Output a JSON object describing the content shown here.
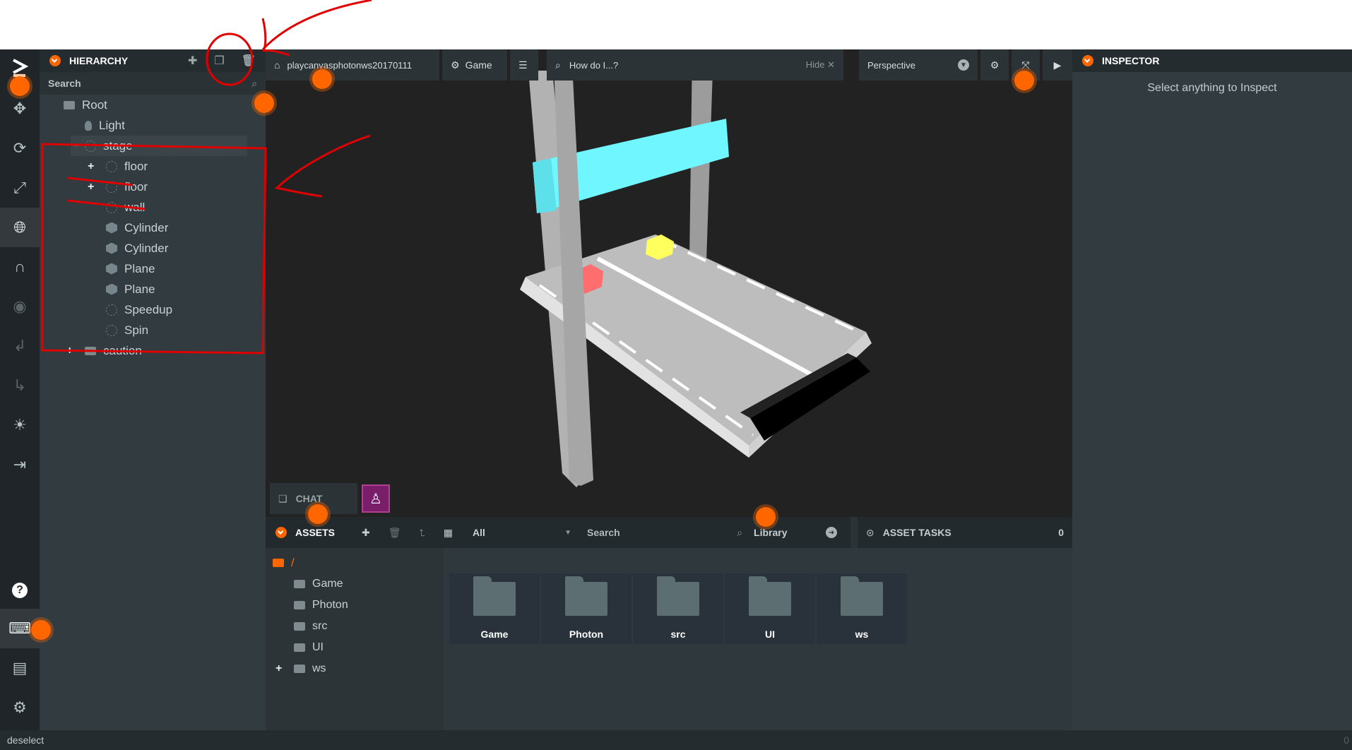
{
  "toolbar": {
    "tools": [
      "logo-icon",
      "move-icon",
      "rotate-icon",
      "scale-icon",
      "world-icon",
      "magnet-icon",
      "eye-icon",
      "undo-icon",
      "redo-icon",
      "light-icon",
      "publish-icon"
    ],
    "bottom_tools": [
      "help-icon",
      "keyboard-icon",
      "feedback-icon",
      "settings-icon"
    ]
  },
  "hierarchy": {
    "title": "HIERARCHY",
    "search_label": "Search",
    "items": [
      {
        "label": "Root",
        "icon": "folder-icon",
        "expander": ""
      },
      {
        "label": "Light",
        "icon": "bulb-icon",
        "expander": ""
      },
      {
        "label": "stage",
        "icon": "entity-icon",
        "expander": "−"
      },
      {
        "label": "floor",
        "icon": "entity-icon",
        "expander": "+"
      },
      {
        "label": "floor",
        "icon": "entity-icon",
        "expander": "+"
      },
      {
        "label": "wall",
        "icon": "entity-icon",
        "expander": ""
      },
      {
        "label": "Cylinder",
        "icon": "box-icon",
        "expander": ""
      },
      {
        "label": "Cylinder",
        "icon": "box-icon",
        "expander": ""
      },
      {
        "label": "Plane",
        "icon": "box-icon",
        "expander": ""
      },
      {
        "label": "Plane",
        "icon": "box-icon",
        "expander": ""
      },
      {
        "label": "Speedup",
        "icon": "entity-icon",
        "expander": ""
      },
      {
        "label": "Spin",
        "icon": "entity-icon",
        "expander": ""
      },
      {
        "label": "caution",
        "icon": "folder-icon",
        "expander": "+"
      }
    ]
  },
  "viewport": {
    "project_name": "playcanvasphotonws20170111",
    "game_label": "Game",
    "help_search": "How do I...?",
    "hide_label": "Hide",
    "camera": "Perspective"
  },
  "chat": {
    "label": "CHAT"
  },
  "assets": {
    "title": "ASSETS",
    "filter": "All",
    "search_label": "Search",
    "library_label": "Library",
    "tasks_title": "ASSET TASKS",
    "tasks_count": "0",
    "root": "/",
    "folders": [
      "Game",
      "Photon",
      "src",
      "UI",
      "ws"
    ]
  },
  "inspector": {
    "title": "INSPECTOR",
    "empty_text": "Select anything to Inspect"
  },
  "status": {
    "text": "deselect",
    "count": "0"
  },
  "colors": {
    "accent": "#ff6600",
    "annotation": "#e00000",
    "cyan_bar": "#6ff6ff"
  }
}
